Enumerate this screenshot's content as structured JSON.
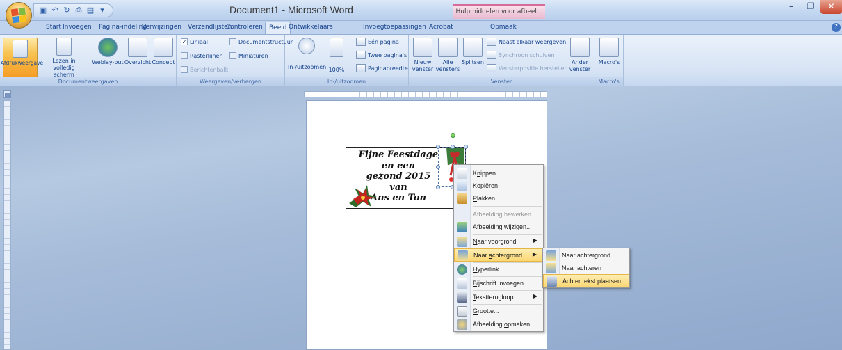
{
  "window": {
    "title": "Document1 - Microsoft Word",
    "context_title": "Hulpmiddelen voor afbeel...",
    "minimize": "–",
    "maximize": "❐",
    "close": "✕"
  },
  "quick_access": [
    "save-icon",
    "undo-icon",
    "redo-icon",
    "print-preview-icon",
    "more-icon"
  ],
  "tabs": [
    "Start",
    "Invoegen",
    "Pagina-indeling",
    "Verwijzingen",
    "Verzendlijsten",
    "Controleren",
    "Beeld",
    "Ontwikkelaars",
    "Invoegtoepassingen",
    "Acrobat",
    "Opmaak"
  ],
  "active_tab": "Beeld",
  "ribbon": {
    "documentweergaven": {
      "label": "Documentweergaven",
      "afdrukweergave": "Afdrukweergave",
      "lezen": "Lezen in volledig scherm",
      "weblay": "Weblay-out",
      "overzicht": "Overzicht",
      "concept": "Concept"
    },
    "weergeven": {
      "label": "Weergeven/verbergen",
      "liniaal": "Liniaal",
      "rasterlijnen": "Rasterlijnen",
      "berichtenbalk": "Berichtenbalk",
      "documentstructuur": "Documentstructuur",
      "miniaturen": "Miniaturen"
    },
    "zoom": {
      "label": "In-/uitzoomen",
      "inuit": "In-/uitzoomen",
      "honderd": "100%",
      "een_pagina": "Eén pagina",
      "twee_paginas": "Twee pagina's",
      "paginabreedte": "Paginabreedte"
    },
    "venster": {
      "label": "Venster",
      "nieuw": "Nieuw venster",
      "alle": "Alle vensters",
      "splitsen": "Splitsen",
      "naast": "Naast elkaar weergeven",
      "synchroon": "Synchroon schuiven",
      "vensterpositie": "Vensterpositie herstellen",
      "ander": "Ander venster"
    },
    "macros": {
      "label": "Macro's",
      "macros": "Macro's"
    }
  },
  "card": {
    "lines": [
      "Fijne Feestdage",
      "en een",
      "gezond 2015",
      "van",
      "Ans en Ton"
    ]
  },
  "context_menu": {
    "items": [
      {
        "pre": "K",
        "u": "n",
        "post": "ippen",
        "icon": "scissors-icon"
      },
      {
        "pre": "",
        "u": "K",
        "post": "opiëren",
        "icon": "copy-icon"
      },
      {
        "pre": "",
        "u": "P",
        "post": "lakken",
        "icon": "paste-icon"
      },
      {
        "pre": "Afbeelding bewerken",
        "u": "",
        "post": "",
        "icon": "none"
      },
      {
        "pre": "",
        "u": "A",
        "post": "fbeelding wijzigen...",
        "icon": "change-picture-icon"
      },
      {
        "pre": "",
        "u": "N",
        "post": "aar voorgrond",
        "icon": "bring-forward-icon"
      },
      {
        "pre": "Naar ",
        "u": "a",
        "post": "chtergrond",
        "icon": "send-backward-icon"
      },
      {
        "pre": "",
        "u": "H",
        "post": "yperlink...",
        "icon": "hyperlink-icon"
      },
      {
        "pre": "",
        "u": "B",
        "post": "ijschrift invoegen...",
        "icon": "caption-icon"
      },
      {
        "pre": "",
        "u": "T",
        "post": "ekstterugloop",
        "icon": "text-wrap-icon"
      },
      {
        "pre": "",
        "u": "G",
        "post": "rootte...",
        "icon": "size-icon"
      },
      {
        "pre": "Afbeelding ",
        "u": "o",
        "post": "pmaken...",
        "icon": "format-picture-icon"
      }
    ]
  },
  "submenu": {
    "items": [
      "Naar achtergrond",
      "Naar achteren",
      "Achter tekst plaatsen"
    ]
  }
}
